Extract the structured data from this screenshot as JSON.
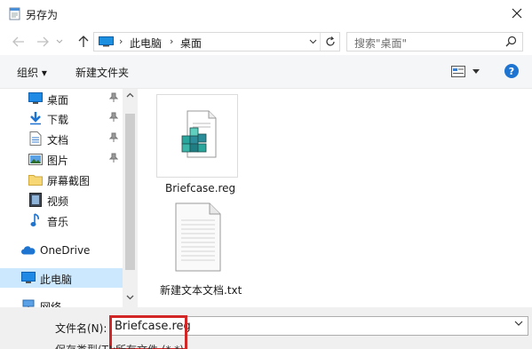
{
  "window": {
    "title": "另存为"
  },
  "address": {
    "crumbs": [
      "此电脑",
      "桌面"
    ],
    "search_placeholder": "搜索\"桌面\""
  },
  "toolbar": {
    "organize_label": "组织 ▾",
    "new_folder_label": "新建文件夹",
    "help_label": "?"
  },
  "nav": {
    "quick_access": [
      {
        "label": "桌面",
        "icon": "desktop-icon",
        "pinned": true
      },
      {
        "label": "下载",
        "icon": "download-icon",
        "pinned": true
      },
      {
        "label": "文档",
        "icon": "document-icon",
        "pinned": true
      },
      {
        "label": "图片",
        "icon": "picture-icon",
        "pinned": true
      },
      {
        "label": "屏幕截图",
        "icon": "folder-icon",
        "pinned": false
      },
      {
        "label": "视频",
        "icon": "video-icon",
        "pinned": false
      },
      {
        "label": "音乐",
        "icon": "music-icon",
        "pinned": false
      }
    ],
    "onedrive": "OneDrive",
    "this_pc": "此电脑",
    "network": "网络"
  },
  "files": [
    {
      "name": "Briefcase.reg",
      "icon": "registry-file-icon"
    },
    {
      "name": "新建文本文档.txt",
      "icon": "text-file-icon"
    }
  ],
  "bottom": {
    "filename_label": "文件名(N):",
    "filename_value": "Briefcase.reg",
    "type_label": "保存类型(T):",
    "type_value": "所有文件 (*.*)"
  },
  "colors": {
    "accent": "#1e74d1",
    "selection": "#cce8ff",
    "highlight_box": "#d22525"
  }
}
